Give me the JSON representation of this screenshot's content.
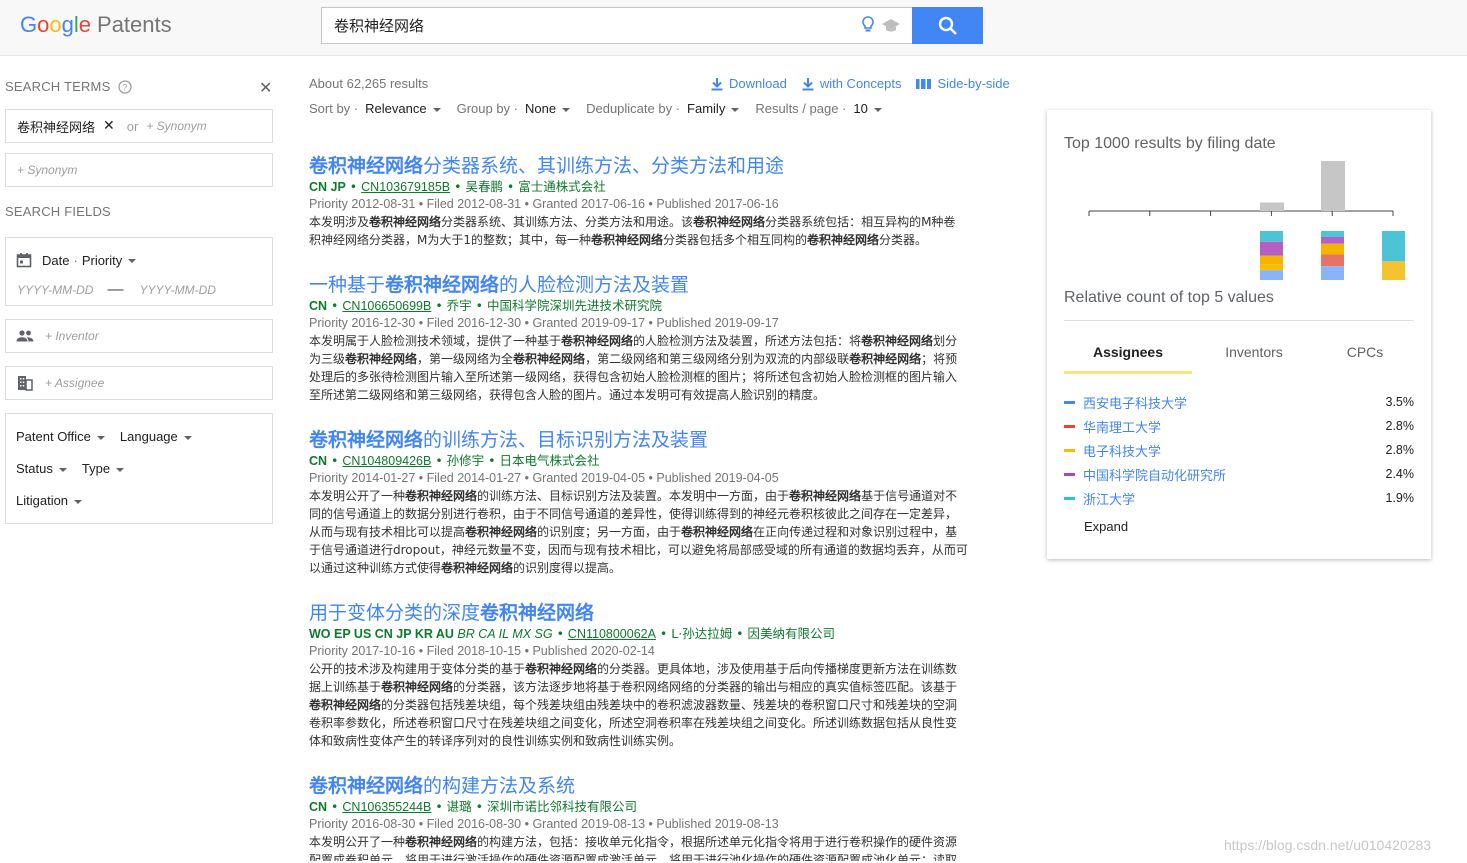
{
  "header": {
    "logo_google": [
      "G",
      "o",
      "o",
      "g",
      "l",
      "e"
    ],
    "logo_product": "Patents",
    "search_value": "卷积神经网络"
  },
  "sidebar": {
    "search_terms_title": "SEARCH TERMS",
    "term_chip": "卷积神经网络",
    "or_label": "or",
    "synonym_placeholder": "+ Synonym",
    "search_fields_title": "SEARCH FIELDS",
    "date_label": "Date",
    "date_type": "Priority",
    "date_from_placeholder": "YYYY-MM-DD",
    "date_to_placeholder": "YYYY-MM-DD",
    "inventor_placeholder": "+ Inventor",
    "assignee_placeholder": "+ Assignee",
    "filters": {
      "patent_office": "Patent Office",
      "language": "Language",
      "status": "Status",
      "type": "Type",
      "litigation": "Litigation"
    }
  },
  "results_header": {
    "count": "About 62,265 results",
    "download": "Download",
    "with_concepts": "with Concepts",
    "side_by_side": "Side-by-side",
    "sort_label": "Sort by",
    "sort_value": "Relevance",
    "group_label": "Group by",
    "group_value": "None",
    "dedup_label": "Deduplicate by",
    "dedup_value": "Family",
    "per_page_label": "Results / page",
    "per_page_value": "10"
  },
  "results": [
    {
      "title_bold": "卷积神经网络",
      "title_rest": "分类器系统、其训练方法、分类方法和用途",
      "countries": "CN JP",
      "countries_italic": "",
      "number": "CN103679185B",
      "people": " • 吴春鹏 • 富士通株式会社",
      "dates": "Priority 2012-08-31 • Filed 2012-08-31 • Granted 2017-06-16 • Published 2017-06-16",
      "snippet": [
        "本发明涉及卷积神经网络分类器系统、其训练方法、分类方法和用途。该卷积神经网络分类器系统包括：相互异构的M种卷",
        "积神经网络分类器，M为大于1的整数；其中，每一种卷积神经网络分类器包括多个相互同构的卷积神经网络分类器。"
      ]
    },
    {
      "title_pre": "一种基于",
      "title_bold": "卷积神经网络",
      "title_rest": "的人脸检测方法及装置",
      "countries": "CN",
      "countries_italic": "",
      "number": "CN106650699B",
      "people": " • 乔宇 • 中国科学院深圳先进技术研究院",
      "dates": "Priority 2016-12-30 • Filed 2016-12-30 • Granted 2019-09-17 • Published 2019-09-17",
      "snippet": [
        "本发明属于人脸检测技术领域，提供了一种基于卷积神经网络的人脸检测方法及装置，所述方法包括：将卷积神经网络划分",
        "为三级卷积神经网络，第一级网络为全卷积神经网络，第二级网络和第三级网络分别为双流的内部级联卷积神经网络；将预",
        "处理后的多张待检测图片输入至所述第一级网络，获得包含初始人脸检测框的图片；将所述包含初始人脸检测框的图片输入",
        "至所述第二级网络和第三级网络，获得包含人脸的图片。通过本发明可有效提高人脸识别的精度。"
      ]
    },
    {
      "title_bold": "卷积神经网络",
      "title_rest": "的训练方法、目标识别方法及装置",
      "countries": "CN",
      "countries_italic": "",
      "number": "CN104809426B",
      "people": " • 孙修宇 • 日本电气株式会社",
      "dates": "Priority 2014-01-27 • Filed 2014-01-27 • Granted 2019-04-05 • Published 2019-04-05",
      "snippet": [
        "本发明公开了一种卷积神经网络的训练方法、目标识别方法及装置。本发明中一方面，由于卷积神经网络基于信号通道对不",
        "同的信号通道上的数据分别进行卷积，由于不同信号通道的差异性，使得训练得到的神经元卷积核彼此之间存在一定差异，",
        "从而与现有技术相比可以提高卷积神经网络的识别度；另一方面，由于卷积神经网络在正向传递过程和对象识别过程中，基",
        "于信号通道进行dropout，神经元数量不变，因而与现有技术相比，可以避免将局部感受域的所有通道的数据均丢弃，从而可",
        "以通过这种训练方式使得卷积神经网络的识别度得以提高。"
      ]
    },
    {
      "title_pre": "用于变体分类的深度",
      "title_bold": "卷积神经网络",
      "title_rest": "",
      "countries": "WO EP US CN JP KR AU ",
      "countries_italic": "BR CA IL MX SG",
      "number": "CN110800062A",
      "people": " • L·孙达拉姆 • 因美纳有限公司",
      "dates": "Priority 2017-10-16 • Filed 2018-10-15 • Published 2020-02-14",
      "snippet": [
        "公开的技术涉及构建用于变体分类的基于卷积神经网络的分类器。更具体地，涉及使用基于后向传播梯度更新方法在训练数",
        "据上训练基于卷积神经网络的分类器，该方法逐步地将基于卷积网络网络的分类器的输出与相应的真实值标签匹配。该基于",
        "卷积神经网络的分类器包括残差块组，每个残差块组由残差块中的卷积滤波器数量、残差块的卷积窗口尺寸和残差块的空洞",
        "卷积率参数化，所述卷积窗口尺寸在残差块组之间变化，所述空洞卷积率在残差块组之间变化。所述训练数据包括从良性变",
        "体和致病性变体产生的转译序列对的良性训练实例和致病性训练实例。"
      ]
    },
    {
      "title_bold": "卷积神经网络",
      "title_rest": "的构建方法及系统",
      "countries": "CN",
      "countries_italic": "",
      "number": "CN106355244B",
      "people": " • 谌璐 • 深圳市诺比邻科技有限公司",
      "dates": "Priority 2016-08-30 • Filed 2016-08-30 • Granted 2019-08-13 • Published 2019-08-13",
      "snippet": [
        "本发明公开了一种卷积神经网络的构建方法，包括：接收单元化指令，根据所述单元化指令将用于进行卷积操作的硬件资源",
        "配置成卷积单元，将用于进行激活操作的硬件资源配置成激活单元，将用于进行池化操作的硬件资源配置成池化单元；读取"
      ]
    }
  ],
  "card": {
    "title": "Top 1000 results by filing date",
    "subtitle": "Relative count of top 5 values",
    "timeline_bars": [
      0.17,
      1.0
    ],
    "stacked_bars": [
      [
        {
          "c": "#4dc3d6",
          "v": 0.22
        },
        {
          "c": "#b45fc8",
          "v": 0.28
        },
        {
          "c": "#f4b400",
          "v": 0.18
        },
        {
          "c": "#fbbc05",
          "v": 0.12
        },
        {
          "c": "#8ab4f8",
          "v": 0.2
        }
      ],
      [
        {
          "c": "#4dc3d6",
          "v": 0.12
        },
        {
          "c": "#b45fc8",
          "v": 0.14
        },
        {
          "c": "#f4b400",
          "v": 0.22
        },
        {
          "c": "#e57368",
          "v": 0.24
        },
        {
          "c": "#8ab4f8",
          "v": 0.28
        }
      ],
      [
        {
          "c": "#4dc3d6",
          "v": 0.62
        },
        {
          "c": "#f4c430",
          "v": 0.38
        }
      ]
    ],
    "tabs": [
      "Assignees",
      "Inventors",
      "CPCs"
    ],
    "assignees": [
      {
        "name": "西安电子科技大学",
        "pct": "3.5%",
        "color": "#4285f4"
      },
      {
        "name": "华南理工大学",
        "pct": "2.8%",
        "color": "#ea4335"
      },
      {
        "name": "电子科技大学",
        "pct": "2.8%",
        "color": "#fbbc05"
      },
      {
        "name": "中国科学院自动化研究所",
        "pct": "2.4%",
        "color": "#ab47bc"
      },
      {
        "name": "浙江大学",
        "pct": "1.9%",
        "color": "#26c6da"
      }
    ],
    "expand": "Expand"
  },
  "watermark": "https://blog.csdn.net/u010420283"
}
